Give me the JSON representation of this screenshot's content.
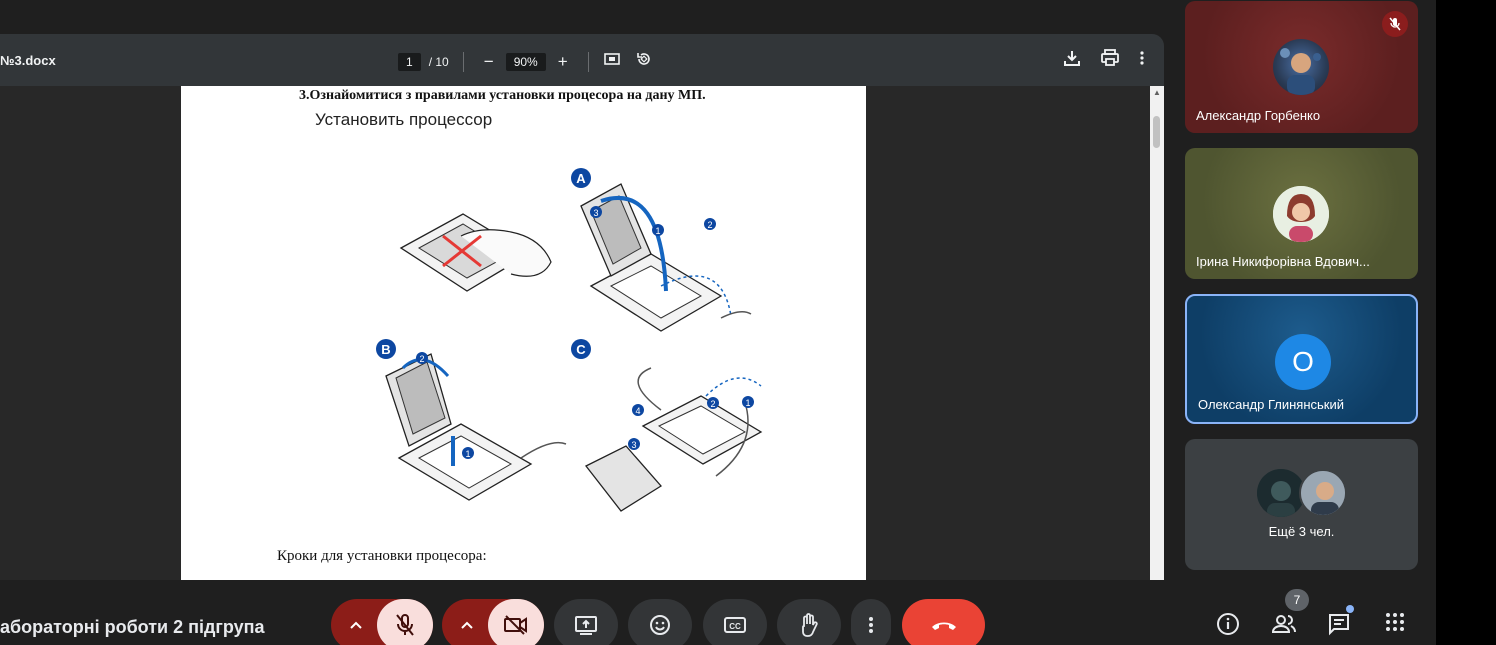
{
  "viewer": {
    "filename": "№3.docx",
    "current_page": "1",
    "total_pages": "/ 10",
    "zoom": "90%"
  },
  "document": {
    "heading": "3.Ознайомитися з правилами установки процесора на дану МП.",
    "subheading": "Установить процессор",
    "steps_label": "Кроки для установки процесора:",
    "figure_labels": [
      "A",
      "B",
      "C"
    ],
    "step_numbers": [
      "1",
      "2",
      "3",
      "4"
    ]
  },
  "participants": [
    {
      "name": "Александр Горбенко",
      "muted": true
    },
    {
      "name": "Ірина Никифорівна Вдович..."
    },
    {
      "name": "Олександр Глинянський",
      "initial": "О",
      "active": true
    },
    {
      "more_label": "Ещё 3 чел."
    }
  ],
  "meeting": {
    "title": "абораторні роботи 2 підгрупа",
    "people_count": "7"
  },
  "colors": {
    "end_call": "#ea4335",
    "mic_off_bg": "#f9dedc",
    "active_border": "#8ab4f8"
  }
}
